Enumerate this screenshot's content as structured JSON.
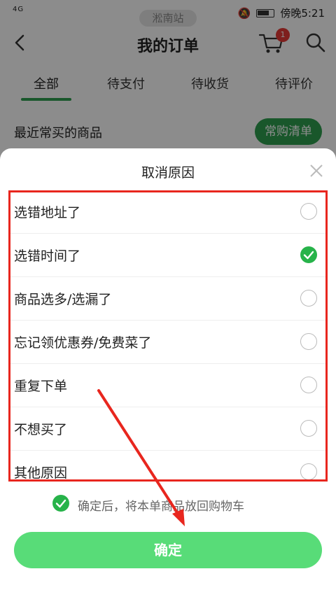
{
  "statusbar": {
    "network": "4G",
    "right_text": "傍晚5:21",
    "station": "淞南站"
  },
  "nav": {
    "title": "我的订单",
    "cart_badge": "1",
    "icons": [
      "back-icon",
      "cart-icon",
      "search-icon"
    ]
  },
  "tabs": [
    {
      "label": "全部",
      "active": true
    },
    {
      "label": "待支付"
    },
    {
      "label": "待收货"
    },
    {
      "label": "待评价"
    }
  ],
  "frequent": {
    "title": "最近常买的商品",
    "button": "常购清单"
  },
  "sheet": {
    "title": "取消原因",
    "reasons": [
      {
        "label": "选错地址了",
        "checked": false
      },
      {
        "label": "选错时间了",
        "checked": true
      },
      {
        "label": "商品选多/选漏了",
        "checked": false
      },
      {
        "label": "忘记领优惠券/免费菜了",
        "checked": false
      },
      {
        "label": "重复下单",
        "checked": false
      },
      {
        "label": "不想买了",
        "checked": false
      },
      {
        "label": "其他原因",
        "checked": false
      }
    ],
    "note": "确定后，将本单商品放回购物车",
    "confirm": "确定"
  },
  "colors": {
    "brand_green": "#2e9e4f",
    "check_green": "#27b34a",
    "confirm_green": "#58dc78",
    "annotation_red": "#e8261e",
    "badge_red": "#e53935"
  }
}
